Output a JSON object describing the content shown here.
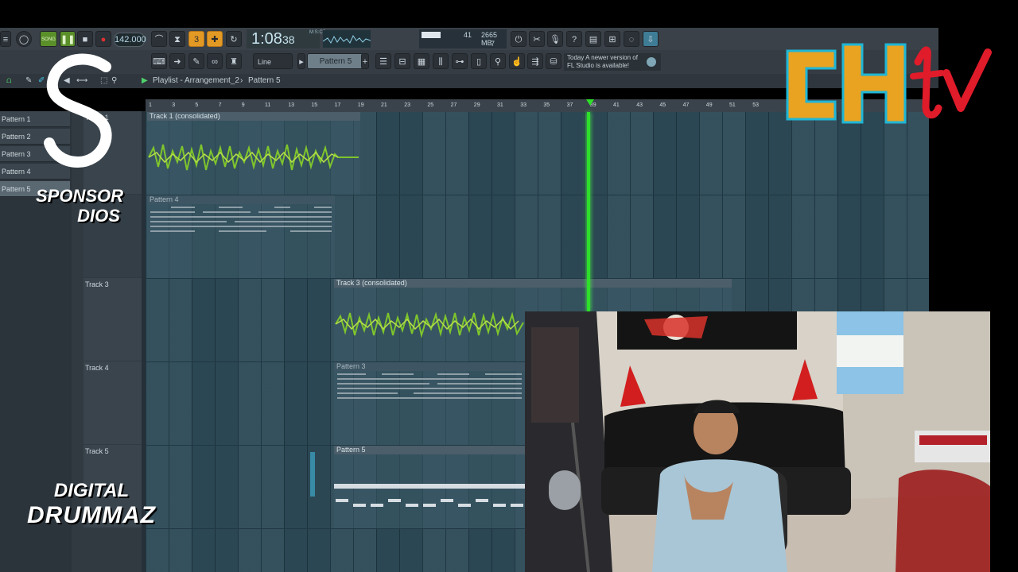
{
  "toolbar": {
    "tempo": "142.000",
    "time_main": "1:08",
    "time_ms": "38",
    "time_unit": "M:S:CS",
    "cpu_value": "41",
    "memory": "2665 MB",
    "polyphony": "7",
    "snap_mode": "Line",
    "pattern_selector": "Pattern 5",
    "pattern_mode": "SONG",
    "hint_line1": "Today  A newer version of",
    "hint_line2": "FL Studio is available!"
  },
  "playlist": {
    "title": "Playlist - Arrangement_2",
    "separator": "›",
    "current_pattern": "Pattern 5",
    "ruler_ticks": [
      "1",
      "3",
      "5",
      "7",
      "9",
      "11",
      "13",
      "15",
      "17",
      "19",
      "21",
      "23",
      "25",
      "27",
      "29",
      "31",
      "33",
      "35",
      "37",
      "39",
      "41",
      "43",
      "45",
      "47",
      "49",
      "51",
      "53"
    ]
  },
  "pattern_list": [
    "Pattern 1",
    "Pattern 2",
    "Pattern 3",
    "Pattern 4",
    "Pattern 5"
  ],
  "tracks": [
    {
      "name": "Track 1"
    },
    {
      "name": "Track 3"
    },
    {
      "name": "Track 4"
    },
    {
      "name": "Track 5"
    }
  ],
  "clips": {
    "track1_audio": "Track 1 (consolidated)",
    "track1_pattern": "Pattern 4",
    "track3_audio": "Track 3 (consolidated)",
    "track4_pattern": "Pattern 3",
    "track5_pattern": "Pattern 5"
  },
  "overlay": {
    "sponsor_line1": "SPONSOR",
    "sponsor_line2": "DIOS",
    "digital_line1": "DIGITAL",
    "digital_line2": "DRUMMAZ",
    "chtv_logo": "CHtv"
  },
  "colors": {
    "playhead": "#2ee02a",
    "accent_orange": "#e39a25",
    "grid": "#2e4b58",
    "chtv_yellow": "#e9a321",
    "chtv_cyan": "#1fb6d6",
    "chtv_red": "#e01b2a"
  }
}
